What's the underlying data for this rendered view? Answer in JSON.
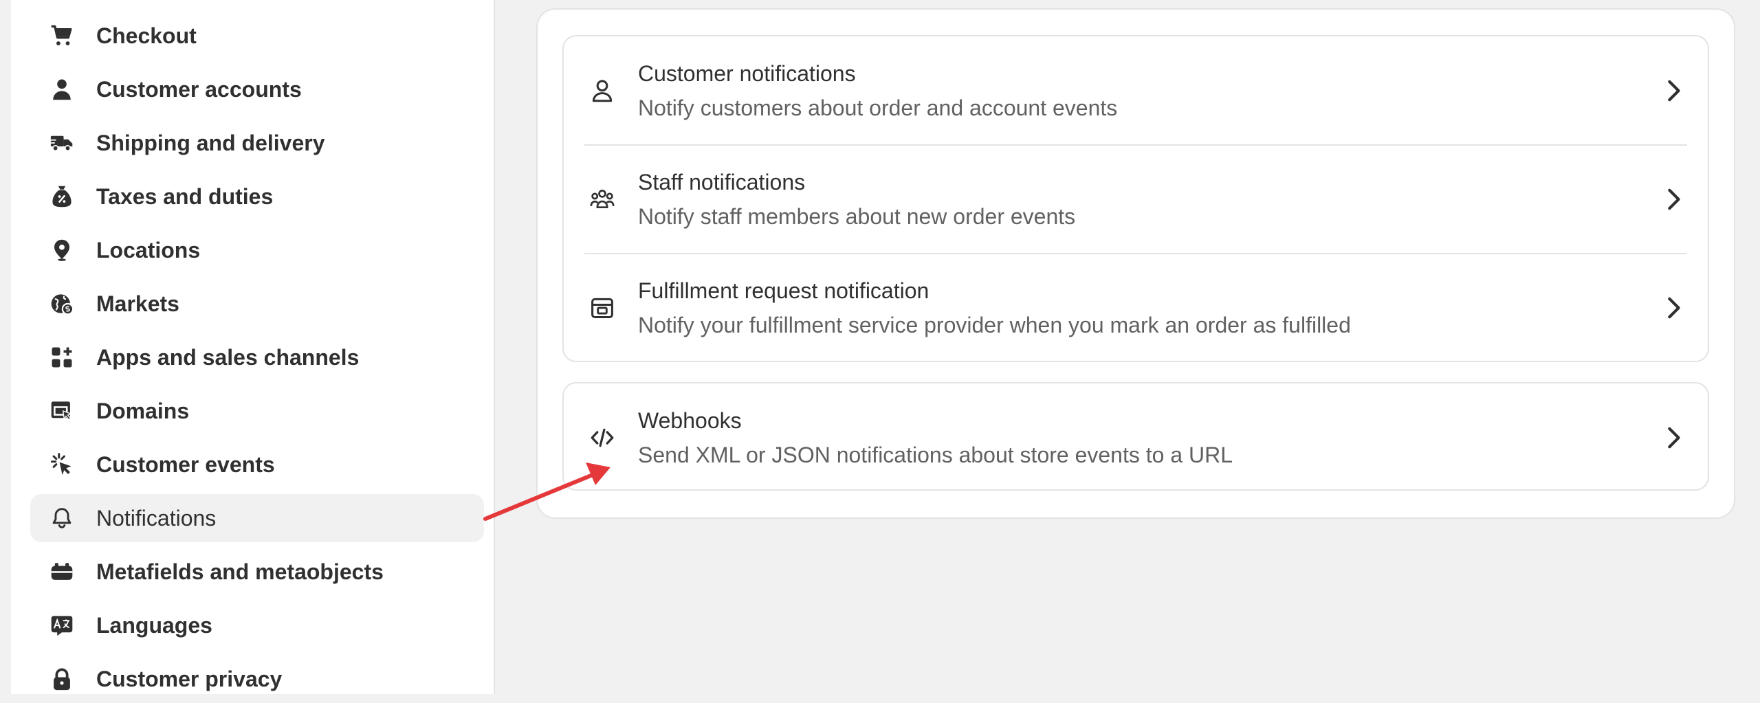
{
  "sidebar": {
    "items": [
      {
        "label": "Checkout",
        "icon": "cart-icon"
      },
      {
        "label": "Customer accounts",
        "icon": "person-icon"
      },
      {
        "label": "Shipping and delivery",
        "icon": "truck-icon"
      },
      {
        "label": "Taxes and duties",
        "icon": "tax-bag-icon"
      },
      {
        "label": "Locations",
        "icon": "location-pin-icon"
      },
      {
        "label": "Markets",
        "icon": "globe-icon"
      },
      {
        "label": "Apps and sales channels",
        "icon": "apps-icon"
      },
      {
        "label": "Domains",
        "icon": "domain-icon"
      },
      {
        "label": "Customer events",
        "icon": "cursor-click-icon"
      },
      {
        "label": "Notifications",
        "icon": "bell-icon",
        "active": true
      },
      {
        "label": "Metafields and metaobjects",
        "icon": "metafield-icon"
      },
      {
        "label": "Languages",
        "icon": "language-icon"
      },
      {
        "label": "Customer privacy",
        "icon": "lock-icon"
      }
    ]
  },
  "notifications": {
    "rows": [
      {
        "title": "Customer notifications",
        "description": "Notify customers about order and account events",
        "icon": "person-outline-icon"
      },
      {
        "title": "Staff notifications",
        "description": "Notify staff members about new order events",
        "icon": "people-icon"
      },
      {
        "title": "Fulfillment request notification",
        "description": "Notify your fulfillment service provider when you mark an order as fulfilled",
        "icon": "store-icon"
      }
    ]
  },
  "webhooks": {
    "title": "Webhooks",
    "description": "Send XML or JSON notifications about store events to a URL",
    "icon": "code-icon"
  },
  "colors": {
    "annotation_arrow": "#e5383b",
    "active_background": "#f1f1f1",
    "page_background": "#f1f1f1"
  }
}
